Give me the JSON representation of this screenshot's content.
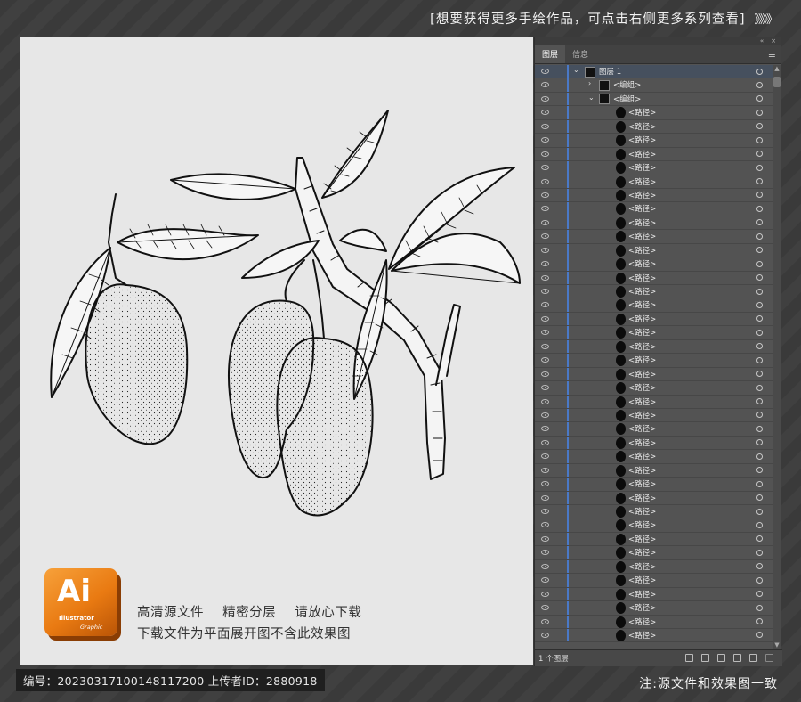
{
  "banner": {
    "text": "[想要获得更多手绘作品，可点击右侧更多系列查看]",
    "arrows": "》》》》"
  },
  "logo": {
    "badge_text": "Ai",
    "sub1": "Illustrator",
    "sub2": "Graphic"
  },
  "promo": {
    "line1": [
      "高清源文件",
      "精密分层",
      "请放心下载"
    ],
    "line2": "下载文件为平面展开图不含此效果图"
  },
  "layers_panel": {
    "tabs": [
      "图层",
      "信息"
    ],
    "active_tab": "图层",
    "top_layer": "图层 1",
    "groups": [
      "<编组>",
      "<编组>"
    ],
    "path_label": "<路径>",
    "path_row_count": 39,
    "footer_text": "1 个图层",
    "highlight_color": "#4a79c7"
  },
  "footer": {
    "info": "编号：20230317100148117200  上传者ID：2880918",
    "note": "注:源文件和效果图一致"
  },
  "colors": {
    "canvas_bg": "#e7e7e7",
    "panel_bg": "#535353",
    "logo_orange": "#e97a12"
  }
}
